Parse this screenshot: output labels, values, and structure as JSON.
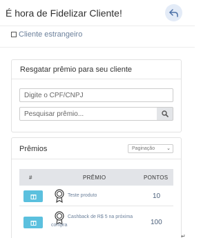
{
  "header": {
    "title": "É hora de Fidelizar Cliente!"
  },
  "foreign_customer": {
    "label": "Cliente estrangeiro"
  },
  "redeem": {
    "title": "Resgatar prêmio para seu cliente",
    "cpf_placeholder": "Digite o CPF/CNPJ",
    "search_placeholder": "Pesquisar prêmio..."
  },
  "prizes": {
    "title": "Prêmios",
    "pagination_label": "Paginação",
    "columns": [
      "#",
      "PRÊMIO",
      "PONTOS"
    ],
    "rows": [
      {
        "name": "Teste produto",
        "points": "10"
      },
      {
        "name": "Cashback de R$ 5 na próxima compra",
        "points": "100"
      }
    ]
  },
  "colors": {
    "accent": "#5bc0de",
    "link": "#6a7f9a",
    "back_button_bg": "#e3ebf7"
  },
  "icons": [
    "back-arrow-icon",
    "search-icon",
    "gift-icon",
    "medal-icon",
    "chevron-down-icon"
  ]
}
